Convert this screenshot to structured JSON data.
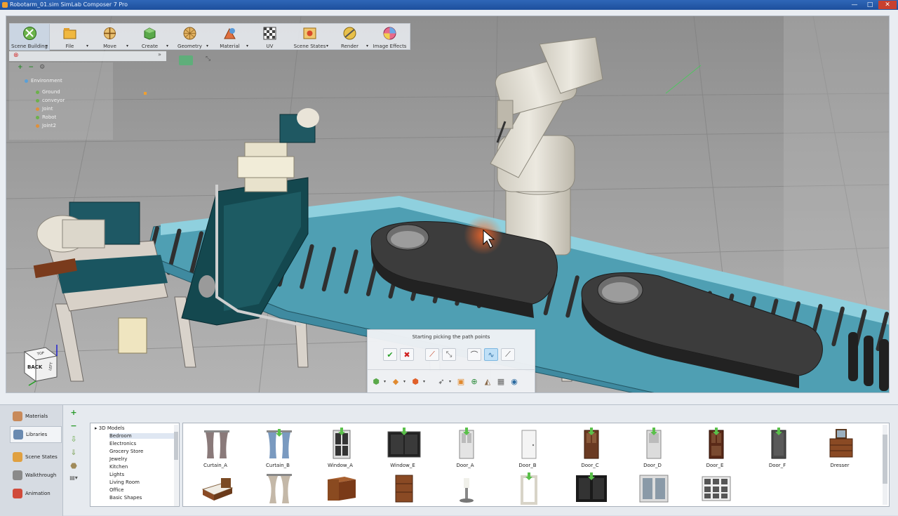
{
  "window": {
    "title": "Robotarm_01.sim SimLab Composer 7 Pro",
    "controls": [
      "—",
      "□",
      "✕"
    ]
  },
  "ribbon": {
    "items": [
      {
        "label": "Scene Building",
        "icon": "scene-building-icon",
        "active": true
      },
      {
        "label": "File",
        "icon": "file-icon"
      },
      {
        "label": "Move",
        "icon": "move-icon"
      },
      {
        "label": "Create",
        "icon": "create-icon"
      },
      {
        "label": "Geometry",
        "icon": "geometry-icon"
      },
      {
        "label": "Material",
        "icon": "material-icon"
      },
      {
        "label": "UV",
        "icon": "uv-icon"
      },
      {
        "label": "Scene States",
        "icon": "scene-states-icon"
      },
      {
        "label": "Render",
        "icon": "render-icon"
      },
      {
        "label": "Image Effects",
        "icon": "image-effects-icon"
      }
    ]
  },
  "scene_tree": {
    "root": "Environment",
    "nodes": [
      "Ground",
      "conveyor",
      "Joint",
      "Robot",
      "Joint2"
    ]
  },
  "nav_cube": {
    "face_front": "BACK",
    "face_side": "LEFT",
    "face_top": "TOP"
  },
  "path_dialog": {
    "message": "Starting picking the path points"
  },
  "bottom_tabs": [
    {
      "label": "Materials"
    },
    {
      "label": "Libraries",
      "active": true
    },
    {
      "label": "Scene States"
    },
    {
      "label": "Walkthrough"
    },
    {
      "label": "Animation"
    }
  ],
  "library_tree": {
    "root": "3D Models",
    "items": [
      "Bedroom",
      "Electronics",
      "Grocery Store",
      "Jewelry",
      "Kitchen",
      "Lights",
      "Living Room",
      "Office",
      "Basic Shapes"
    ],
    "selected": "Bedroom"
  },
  "library_items": {
    "row1": [
      "Curtain_A",
      "Curtain_B",
      "Window_A",
      "Window_E",
      "Door_A",
      "Door_B",
      "Door_C",
      "Door_D",
      "Door_E",
      "Door_F",
      "Dresser"
    ]
  },
  "colors": {
    "titlebar": "#1d4f9c",
    "floor": "#a8a8a8",
    "machine_teal": "#14484f",
    "conveyor_blue": "#5fa7b8"
  }
}
